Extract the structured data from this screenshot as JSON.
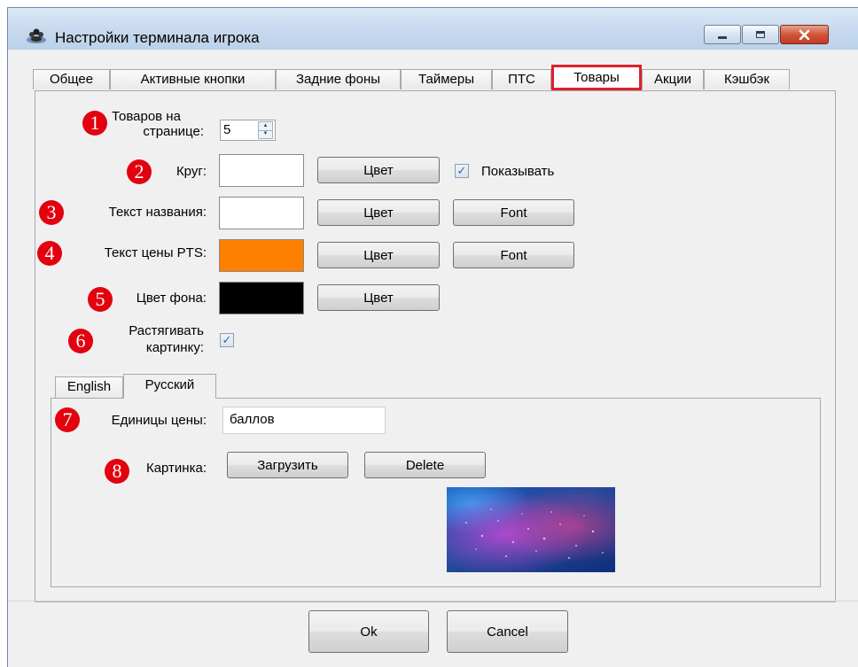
{
  "window": {
    "title": "Настройки терминала игрока",
    "icon": "players-icon"
  },
  "tabs": [
    {
      "label": "Общее",
      "active": false
    },
    {
      "label": "Активные кнопки",
      "active": false
    },
    {
      "label": "Задние фоны",
      "active": false
    },
    {
      "label": "Таймеры",
      "active": false
    },
    {
      "label": "ПТС",
      "active": false
    },
    {
      "label": "Товары",
      "active": true
    },
    {
      "label": "Акции",
      "active": false
    },
    {
      "label": "Кэшбэк",
      "active": false
    }
  ],
  "accent_highlight": "#e0202a",
  "markers": [
    "1",
    "2",
    "3",
    "4",
    "5",
    "6",
    "7",
    "8"
  ],
  "settings": {
    "items_per_page": {
      "label_line1": "Товаров на",
      "label_line2": "странице:",
      "value": "5"
    },
    "circle": {
      "label": "Круг:",
      "color": "#ffffff",
      "color_button": "Цвет",
      "show_label": "Показывать",
      "show_checked": true
    },
    "name_text": {
      "label": "Текст названия:",
      "color": "#ffffff",
      "color_button": "Цвет",
      "font_button": "Font"
    },
    "price_text": {
      "label": "Текст цены PTS:",
      "color": "#ff8000",
      "color_button": "Цвет",
      "font_button": "Font"
    },
    "background_color": {
      "label": "Цвет фона:",
      "color": "#000000",
      "color_button": "Цвет"
    },
    "stretch_image": {
      "label_line1": "Растягивать",
      "label_line2": "картинку:",
      "checked": true
    }
  },
  "language_tabs": [
    {
      "label": "English",
      "active": false
    },
    {
      "label": "Русский",
      "active": true
    }
  ],
  "localized": {
    "price_units": {
      "label": "Единицы цены:",
      "value": "баллов"
    },
    "picture": {
      "label": "Картинка:",
      "load_button": "Загрузить",
      "delete_button": "Delete"
    }
  },
  "footer": {
    "ok": "Ok",
    "cancel": "Cancel"
  }
}
